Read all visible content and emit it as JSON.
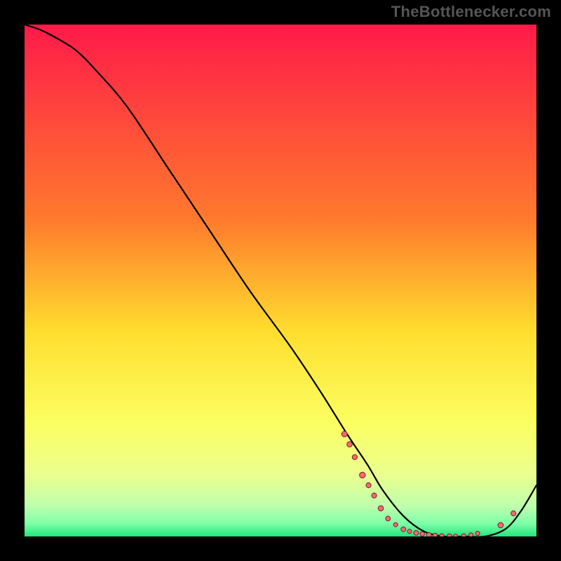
{
  "watermark": "TheBottlenecker.com",
  "chart_data": {
    "type": "line",
    "title": "",
    "xlabel": "",
    "ylabel": "",
    "xlim": [
      0,
      100
    ],
    "ylim": [
      0,
      100
    ],
    "grid": false,
    "gradient_stops": [
      {
        "offset": 0.0,
        "color": "#ff1a49"
      },
      {
        "offset": 0.38,
        "color": "#ff7a2d"
      },
      {
        "offset": 0.6,
        "color": "#ffde2e"
      },
      {
        "offset": 0.78,
        "color": "#fbff62"
      },
      {
        "offset": 0.88,
        "color": "#eaff8f"
      },
      {
        "offset": 0.94,
        "color": "#bfffab"
      },
      {
        "offset": 0.975,
        "color": "#7effa8"
      },
      {
        "offset": 1.0,
        "color": "#22e57a"
      }
    ],
    "series": [
      {
        "name": "bottleneck-curve",
        "x": [
          0,
          3,
          6,
          10,
          14,
          20,
          28,
          36,
          44,
          52,
          58,
          63,
          67,
          70,
          74,
          78,
          82,
          86,
          90,
          94,
          97,
          100
        ],
        "y": [
          100,
          99,
          97.5,
          95,
          91,
          84,
          72,
          60,
          48,
          37,
          28,
          20,
          14,
          9,
          4,
          1,
          0,
          0,
          0,
          1.5,
          5,
          10
        ]
      }
    ],
    "markers": [
      {
        "x": 62.5,
        "y": 20.0,
        "r": 4.0
      },
      {
        "x": 63.5,
        "y": 18.0,
        "r": 3.8
      },
      {
        "x": 64.5,
        "y": 15.5,
        "r": 3.6
      },
      {
        "x": 66.0,
        "y": 12.0,
        "r": 4.2
      },
      {
        "x": 67.2,
        "y": 10.0,
        "r": 3.6
      },
      {
        "x": 68.3,
        "y": 8.0,
        "r": 3.6
      },
      {
        "x": 69.6,
        "y": 5.5,
        "r": 3.8
      },
      {
        "x": 71.0,
        "y": 3.5,
        "r": 3.4
      },
      {
        "x": 72.5,
        "y": 2.3,
        "r": 3.0
      },
      {
        "x": 74.0,
        "y": 1.4,
        "r": 3.4
      },
      {
        "x": 75.2,
        "y": 1.0,
        "r": 3.0
      },
      {
        "x": 76.5,
        "y": 0.7,
        "r": 3.4
      },
      {
        "x": 77.7,
        "y": 0.5,
        "r": 3.2
      },
      {
        "x": 79.0,
        "y": 0.3,
        "r": 3.4
      },
      {
        "x": 80.2,
        "y": 0.2,
        "r": 3.2
      },
      {
        "x": 81.5,
        "y": 0.1,
        "r": 3.2
      },
      {
        "x": 83.0,
        "y": 0.05,
        "r": 3.4
      },
      {
        "x": 84.2,
        "y": 0.05,
        "r": 3.0
      },
      {
        "x": 85.8,
        "y": 0.1,
        "r": 3.2
      },
      {
        "x": 87.2,
        "y": 0.3,
        "r": 3.0
      },
      {
        "x": 88.5,
        "y": 0.6,
        "r": 3.0
      },
      {
        "x": 93.0,
        "y": 2.2,
        "r": 3.8
      },
      {
        "x": 95.5,
        "y": 4.5,
        "r": 3.6
      }
    ],
    "marker_style": {
      "fill": "#f46a72",
      "stroke": "#7a1f28",
      "stroke_width": 1
    },
    "line_style": {
      "stroke": "#000000",
      "stroke_width": 2.2
    }
  }
}
